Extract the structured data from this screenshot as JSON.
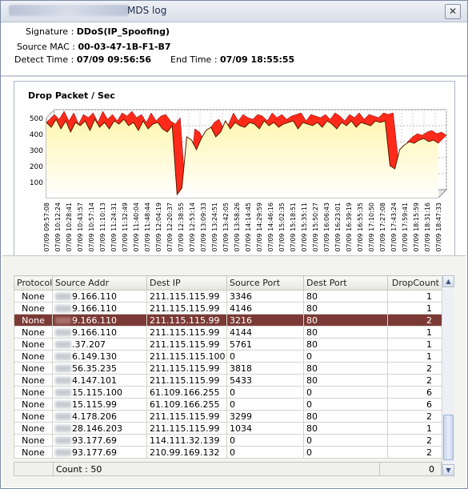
{
  "window": {
    "title": "MDS log",
    "close_icon": "close-icon"
  },
  "info": {
    "signature_label": "Signature :",
    "signature_value": "DDoS(IP_Spoofing)",
    "source_mac_label": "Source MAC :",
    "source_mac_value": "00-03-47-1B-F1-B7",
    "detect_time_label": "Detect Time :",
    "detect_time_value": "07/09  09:56:56",
    "end_time_label": "End Time :",
    "end_time_value": "07/09  18:55:55"
  },
  "chart_data": {
    "type": "area",
    "title": "Drop Packet / Sec",
    "ylim": [
      0,
      500
    ],
    "yticks": [
      100,
      200,
      300,
      400,
      500
    ],
    "grid": true,
    "x_tick_labels": [
      "07/09 09:57:08",
      "07/09 10:12:24",
      "07/09 10:28:41",
      "07/09 10:43:57",
      "07/09 10:57:14",
      "07/09 11:10:13",
      "07/09 11:24:31",
      "07/09 11:32:49",
      "07/09 11:40:04",
      "07/09 11:48:44",
      "07/09 12:04:19",
      "07/09 12:20:37",
      "07/09 12:38:55",
      "07/09 12:53:14",
      "07/09 13:09:33",
      "07/09 13:24:51",
      "07/09 13:42:05",
      "07/09 13:58:26",
      "07/09 14:14:45",
      "07/09 14:29:59",
      "07/09 14:46:16",
      "07/09 15:02:35",
      "07/09 15:18:51",
      "07/09 15:35:11",
      "07/09 15:50:27",
      "07/09 16:06:43",
      "07/09 16:23:01",
      "07/09 16:39:19",
      "07/09 16:55:35",
      "07/09 17:10:50",
      "07/09 17:27:08",
      "07/09 17:43:24",
      "07/09 17:59:41",
      "07/09 18:15:59",
      "07/09 18:31:16",
      "07/09 18:47:33"
    ],
    "values": [
      470,
      440,
      490,
      430,
      480,
      410,
      470,
      450,
      480,
      420,
      490,
      440,
      470,
      430,
      480,
      460,
      490,
      450,
      470,
      420,
      480,
      430,
      460,
      470,
      430,
      410,
      450,
      20,
      60,
      380,
      360,
      300,
      370,
      420,
      440,
      380,
      410,
      480,
      430,
      470,
      450,
      440,
      470,
      460,
      430,
      480,
      450,
      470,
      440,
      460,
      470,
      480,
      430,
      470,
      460,
      450,
      470,
      440,
      480,
      460,
      430,
      470,
      450,
      480,
      440,
      470,
      460,
      450,
      480,
      470,
      480,
      200,
      180,
      300,
      330,
      350,
      340,
      360,
      370,
      350,
      360,
      340
    ]
  },
  "table": {
    "columns": [
      "Protocol",
      "Source Addr",
      "Dest IP",
      "Source Port",
      "Dest Port",
      "DropCount"
    ],
    "rows": [
      {
        "protocol": "None",
        "source": "9.166.110",
        "dest": "211.115.115.99",
        "sport": "3346",
        "dport": "80",
        "count": "1"
      },
      {
        "protocol": "None",
        "source": "9.166.110",
        "dest": "211.115.115.99",
        "sport": "4146",
        "dport": "80",
        "count": "1"
      },
      {
        "protocol": "None",
        "source": "9.166.110",
        "dest": "211.115.115.99",
        "sport": "3216",
        "dport": "80",
        "count": "2"
      },
      {
        "protocol": "None",
        "source": "9.166.110",
        "dest": "211.115.115.99",
        "sport": "4144",
        "dport": "80",
        "count": "1"
      },
      {
        "protocol": "None",
        "source": ".37.207",
        "dest": "211.115.115.99",
        "sport": "5761",
        "dport": "80",
        "count": "1"
      },
      {
        "protocol": "None",
        "source": "6.149.130",
        "dest": "211.115.115.100",
        "sport": "0",
        "dport": "0",
        "count": "1"
      },
      {
        "protocol": "None",
        "source": "56.35.235",
        "dest": "211.115.115.99",
        "sport": "3818",
        "dport": "80",
        "count": "2"
      },
      {
        "protocol": "None",
        "source": "4.147.101",
        "dest": "211.115.115.99",
        "sport": "5433",
        "dport": "80",
        "count": "2"
      },
      {
        "protocol": "None",
        "source": "15.115.100",
        "dest": "61.109.166.255",
        "sport": "0",
        "dport": "0",
        "count": "6"
      },
      {
        "protocol": "None",
        "source": "15.115.99",
        "dest": "61.109.166.255",
        "sport": "0",
        "dport": "0",
        "count": "6"
      },
      {
        "protocol": "None",
        "source": "4.178.206",
        "dest": "211.115.115.99",
        "sport": "3299",
        "dport": "80",
        "count": "2"
      },
      {
        "protocol": "None",
        "source": "28.146.203",
        "dest": "211.115.115.99",
        "sport": "1034",
        "dport": "80",
        "count": "1"
      },
      {
        "protocol": "None",
        "source": "93.177.69",
        "dest": "114.111.32.139",
        "sport": "0",
        "dport": "0",
        "count": "2"
      },
      {
        "protocol": "None",
        "source": "93.177.69",
        "dest": "210.99.169.132",
        "sport": "0",
        "dport": "0",
        "count": "2"
      }
    ],
    "selected_row": 2
  },
  "footer": {
    "count_text": "Count : 50",
    "total_text": "0"
  },
  "colors": {
    "chart_fill_top": "#ff2a1a",
    "chart_fill_body": "#fff6b0",
    "selected_row": "#7b3a36"
  }
}
